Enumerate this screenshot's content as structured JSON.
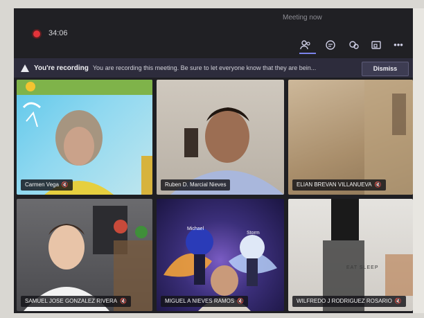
{
  "header": {
    "meeting_title": "Meeting now",
    "timer": "34:06"
  },
  "toolbar": {
    "icons": [
      "people-icon",
      "chat-icon",
      "reactions-icon",
      "share-tray-icon",
      "more-icon"
    ],
    "more_label": "•••"
  },
  "banner": {
    "title": "You're recording",
    "message": "You are recording this meeting. Be sure to let everyone know that they are bein...",
    "dismiss_label": "Dismiss"
  },
  "participants": [
    {
      "name": "Carmen Vega"
    },
    {
      "name": "Ruben D. Marcial Nieves"
    },
    {
      "name": "ELIAN BREVAN VILLANUEVA"
    },
    {
      "name": "SAMUEL JOSE GONZALEZ RIVERA"
    },
    {
      "name": "MIGUEL A NIEVES RAMOS"
    },
    {
      "name": "WILFREDO J RODRIGUEZ ROSARIO"
    }
  ],
  "tile_overlays": {
    "avatar_left": "Michael",
    "avatar_right": "Storm",
    "background_text": "EAT SLEEP"
  },
  "colors": {
    "recording_red": "#e3343b",
    "accent": "#7b83eb",
    "banner_bg": "#2d2c3c"
  }
}
